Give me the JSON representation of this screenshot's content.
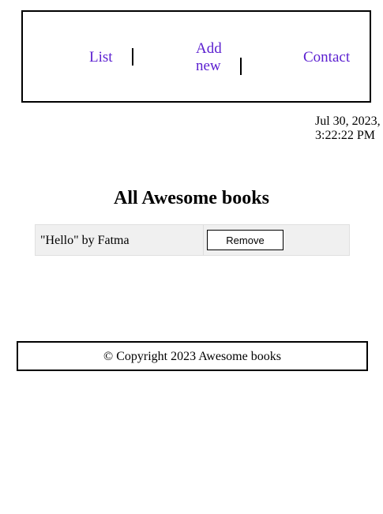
{
  "nav": {
    "links": [
      {
        "label": "List"
      },
      {
        "label": "Add new"
      },
      {
        "label": "Contact"
      }
    ],
    "link_color": "#5b1fd0"
  },
  "datetime": {
    "date": "Jul 30, 2023,",
    "time": "3:22:22 PM"
  },
  "main": {
    "title": "All Awesome books",
    "books": [
      {
        "text": "\"Hello\" by Fatma",
        "remove_label": "Remove"
      }
    ]
  },
  "footer": {
    "text": "© Copyright 2023 Awesome books"
  }
}
